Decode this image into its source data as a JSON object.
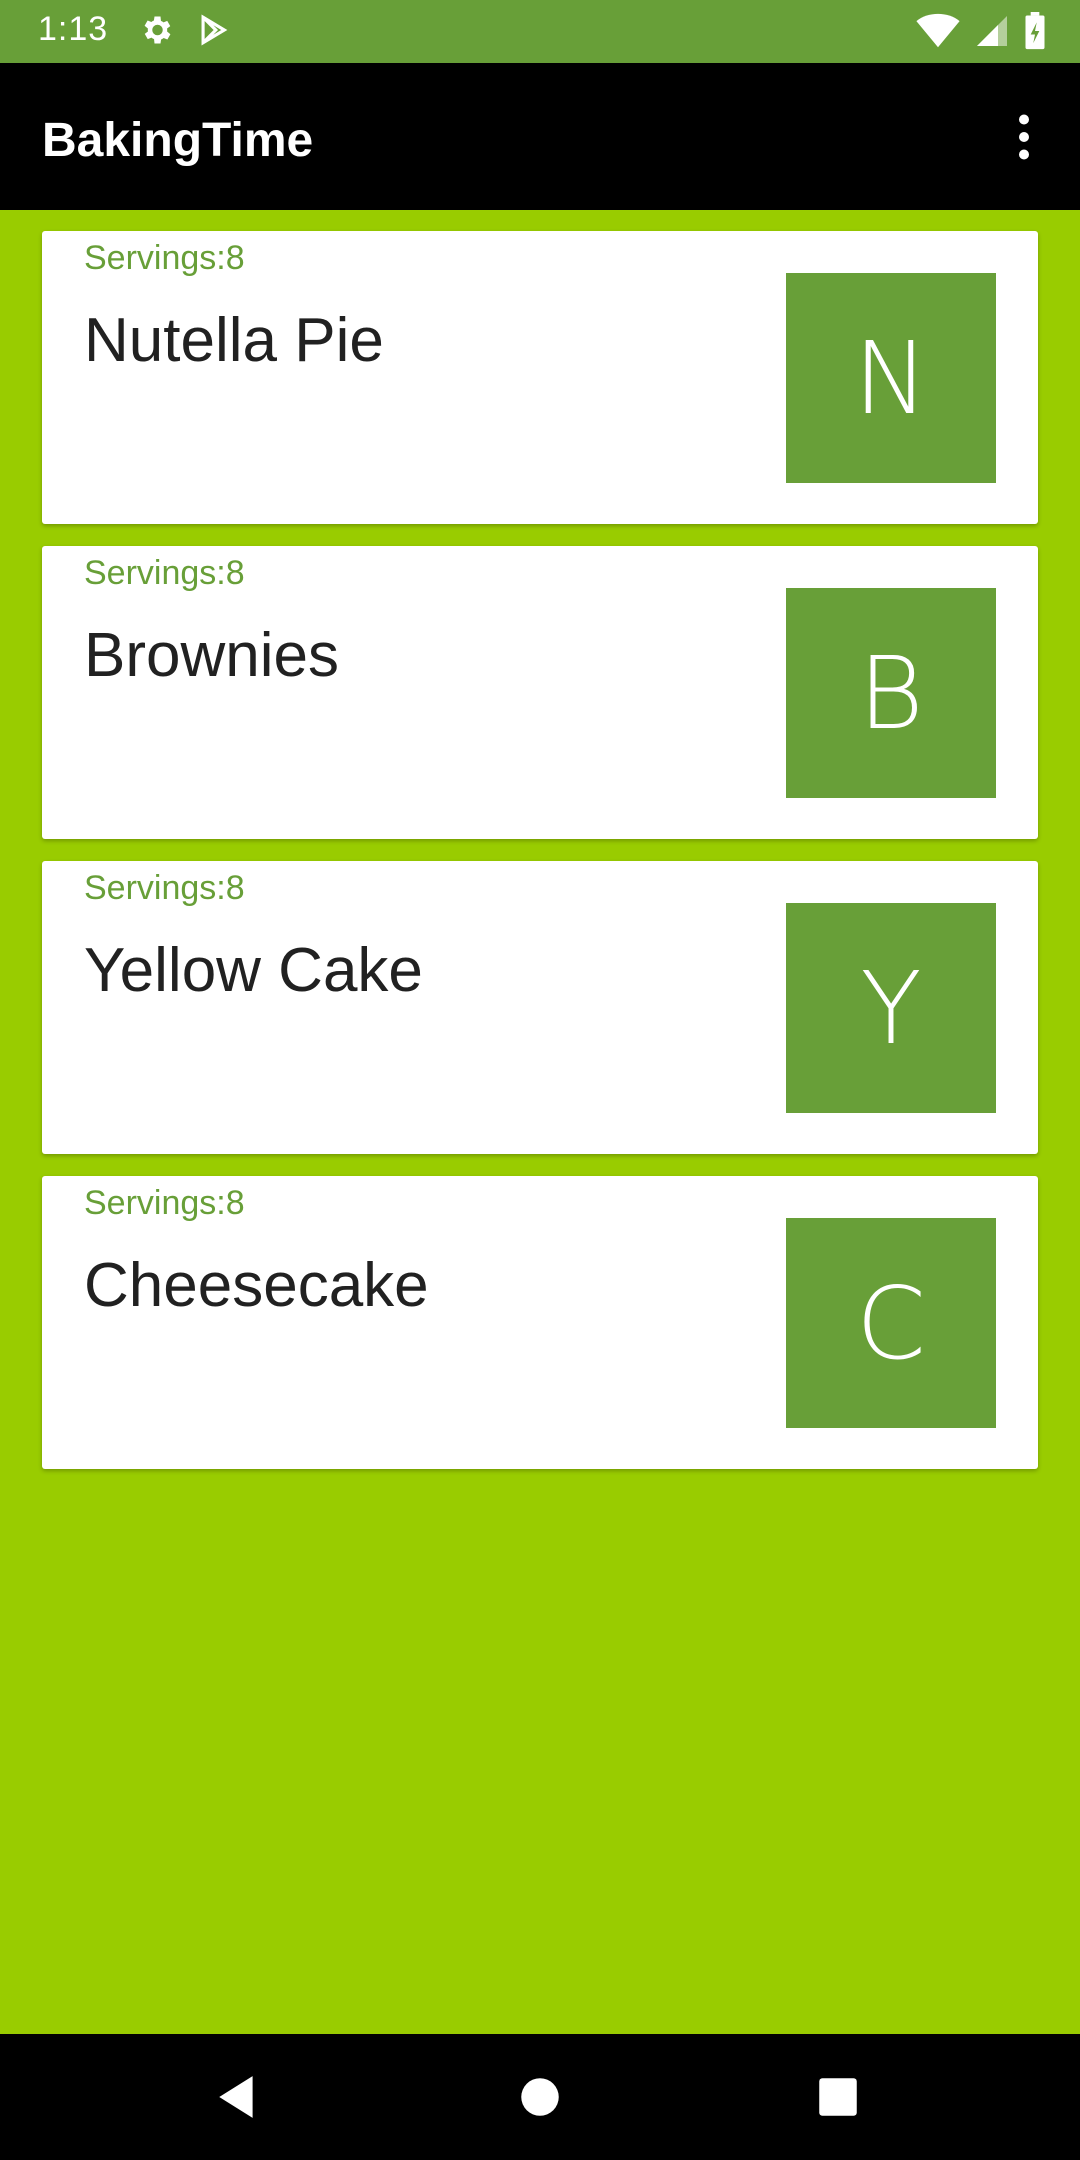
{
  "status_bar": {
    "time": "1:13",
    "icons": [
      "settings-icon",
      "play-store-icon",
      "wifi-icon",
      "signal-icon",
      "battery-icon"
    ]
  },
  "app_bar": {
    "title": "BakingTime",
    "menu_icon": "more-vert-icon"
  },
  "recipes": [
    {
      "servings": "Servings:8",
      "name": "Nutella Pie",
      "initial": "N"
    },
    {
      "servings": "Servings:8",
      "name": "Brownies",
      "initial": "B"
    },
    {
      "servings": "Servings:8",
      "name": "Yellow Cake",
      "initial": "Y"
    },
    {
      "servings": "Servings:8",
      "name": "Cheesecake",
      "initial": "C"
    }
  ],
  "nav_bar": {
    "icons": [
      "back-icon",
      "home-icon",
      "recents-icon"
    ]
  },
  "colors": {
    "status_bar": "#689f38",
    "background": "#99cc00",
    "accent": "#689f38",
    "app_bar": "#000000"
  }
}
